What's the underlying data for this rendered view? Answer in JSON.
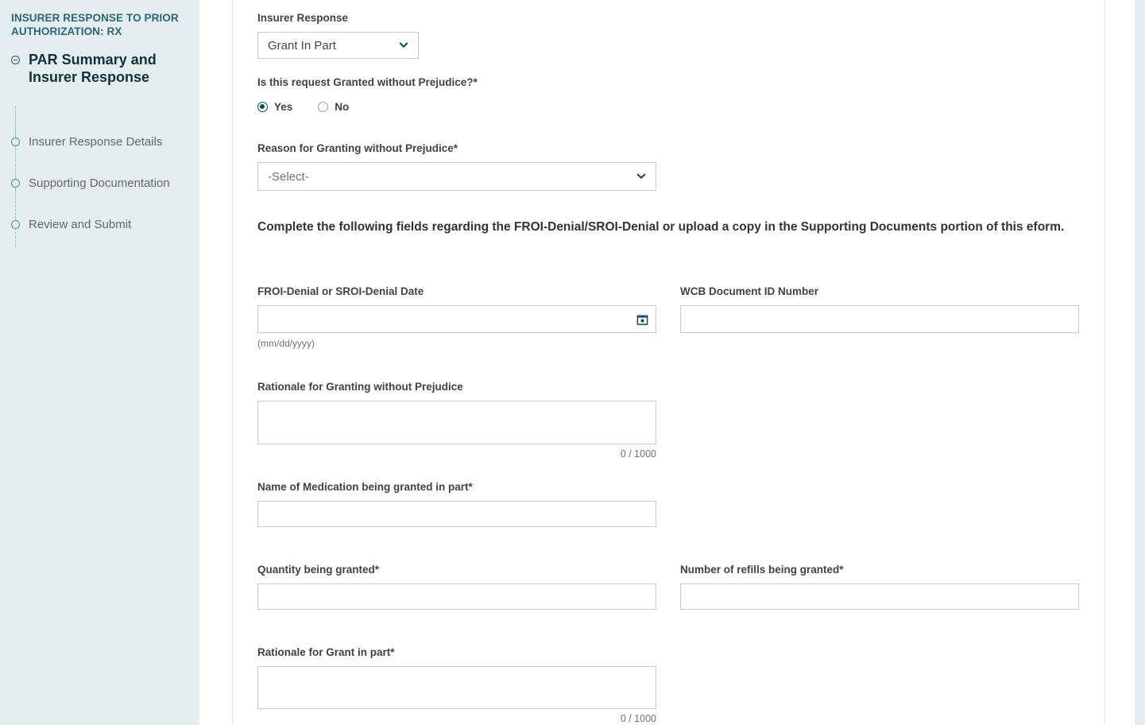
{
  "sidebar": {
    "title": "INSURER RESPONSE TO PRIOR AUTHORIZATION: RX",
    "active_item": "PAR Summary and Insurer Response",
    "items": [
      {
        "label": "Insurer Response Details"
      },
      {
        "label": "Supporting Documentation"
      },
      {
        "label": "Review and Submit"
      }
    ]
  },
  "form": {
    "insurer_response": {
      "label": "Insurer Response",
      "value": "Grant In Part"
    },
    "granted_without_prejudice": {
      "label": "Is this request Granted without Prejudice?*",
      "selected": "Yes",
      "options": [
        "Yes",
        "No"
      ]
    },
    "reason_for_granting": {
      "label": "Reason for Granting without Prejudice*",
      "value": "-Select-"
    },
    "section_note": "Complete the following fields regarding the FROI-Denial/SROI-Denial or upload a copy in the Supporting Documents portion of this eform.",
    "froi_denial_date": {
      "label": "FROI-Denial or SROI-Denial Date",
      "value": "",
      "placeholder": "",
      "hint": "(mm/dd/yyyy)"
    },
    "wcb_document_id": {
      "label": "WCB Document ID Number",
      "value": "",
      "placeholder": ""
    },
    "rationale_granting": {
      "label": "Rationale for Granting without Prejudice",
      "value": "",
      "counter": "0 / 1000"
    },
    "medication_name": {
      "label": "Name of Medication being granted in part*",
      "value": ""
    },
    "quantity_granted": {
      "label": "Quantity being granted*",
      "value": ""
    },
    "refills_granted": {
      "label": "Number of refills being granted*",
      "value": ""
    },
    "rationale_grant_in_part": {
      "label": "Rationale for Grant in part*",
      "value": "",
      "counter": "0 / 1000"
    }
  },
  "colors": {
    "sidebar_bg": "#e4eef0",
    "accent_teal": "#0f4a5a",
    "title_teal": "#2b6575",
    "border_gray": "#c6c9cb",
    "label_gray": "#3d4347"
  }
}
